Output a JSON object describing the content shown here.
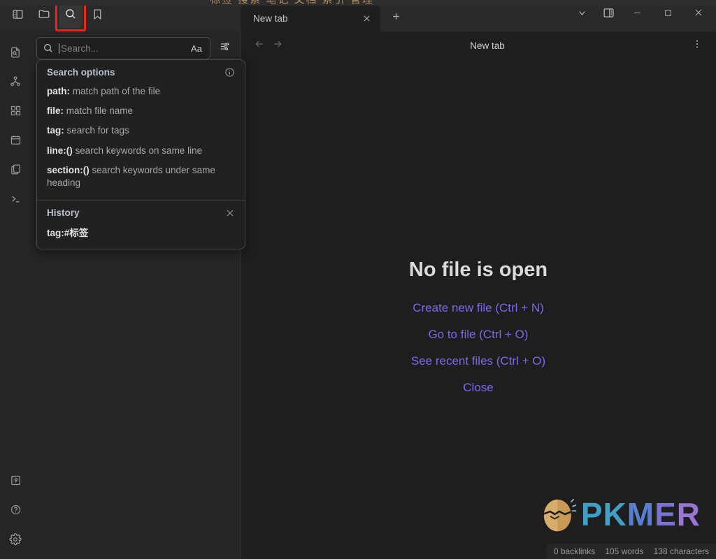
{
  "top_bleed": {
    "text": "标签  搜索  笔记  文档  索引  管理"
  },
  "titlebar": {
    "ribbon": [
      {
        "name": "toggle-left-sidebar",
        "icon": "sidebar-icon",
        "label": "Toggle left sidebar"
      },
      {
        "name": "open-folder",
        "icon": "folder-icon",
        "label": "Files"
      },
      {
        "name": "search",
        "icon": "search-icon",
        "label": "Search"
      },
      {
        "name": "bookmarks",
        "icon": "bookmark-icon",
        "label": "Bookmarks"
      }
    ],
    "tab": {
      "title": "New tab",
      "close_label": "×"
    },
    "new_tab_label": "+",
    "controls": [
      {
        "name": "tab-list-dropdown",
        "icon": "chevron-down-icon"
      },
      {
        "name": "toggle-right-sidebar",
        "icon": "right-sidebar-icon"
      },
      {
        "name": "minimize-window",
        "icon": "minimize-icon"
      },
      {
        "name": "maximize-window",
        "icon": "maximize-icon"
      },
      {
        "name": "close-window",
        "icon": "close-icon"
      }
    ]
  },
  "rail": {
    "top": [
      {
        "name": "quick-switcher",
        "icon": "file-search-icon"
      },
      {
        "name": "graph-view",
        "icon": "graph-icon"
      },
      {
        "name": "canvas",
        "icon": "grid-icon"
      },
      {
        "name": "daily-note",
        "icon": "calendar-icon"
      },
      {
        "name": "templates",
        "icon": "copy-files-icon"
      },
      {
        "name": "terminal",
        "icon": "terminal-icon"
      }
    ],
    "bottom": [
      {
        "name": "vault-switcher",
        "icon": "vault-icon"
      },
      {
        "name": "help",
        "icon": "help-circle-icon"
      },
      {
        "name": "settings",
        "icon": "gear-icon"
      }
    ]
  },
  "search_panel": {
    "input": {
      "value": "",
      "placeholder": "Search..."
    },
    "match_case_label": "Aa",
    "filter_icon": "sliders-icon",
    "options": {
      "title": "Search options",
      "info_icon": "info-circle-icon",
      "items": [
        {
          "key": "path:",
          "desc": " match path of the file"
        },
        {
          "key": "file:",
          "desc": " match file name"
        },
        {
          "key": "tag:",
          "desc": " search for tags"
        },
        {
          "key": "line:()",
          "desc": " search keywords on same line"
        },
        {
          "key": "section:()",
          "desc": " search keywords under same heading"
        }
      ]
    },
    "history": {
      "title": "History",
      "clear_icon": "close-icon",
      "items": [
        "tag:#标签"
      ]
    }
  },
  "main": {
    "back_icon": "arrow-left-icon",
    "forward_icon": "arrow-right-icon",
    "title": "New tab",
    "more_icon": "more-vertical-icon",
    "empty_state": {
      "heading": "No file is open",
      "links": [
        "Create new file (Ctrl + N)",
        "Go to file (Ctrl + O)",
        "See recent files (Ctrl + O)",
        "Close"
      ]
    }
  },
  "watermark": {
    "letters": [
      "P",
      "K",
      "M",
      "E",
      "R"
    ],
    "logo": "egg-icon"
  },
  "statusbar": {
    "items": [
      "0 backlinks",
      "105 words",
      "138 characters"
    ]
  },
  "colors": {
    "accent_link": "#7b68ee",
    "highlight_box": "#e8261d",
    "panel_bg": "#262626",
    "main_bg": "#1e1e1e",
    "titlebar_bg": "#2a2a2a"
  }
}
